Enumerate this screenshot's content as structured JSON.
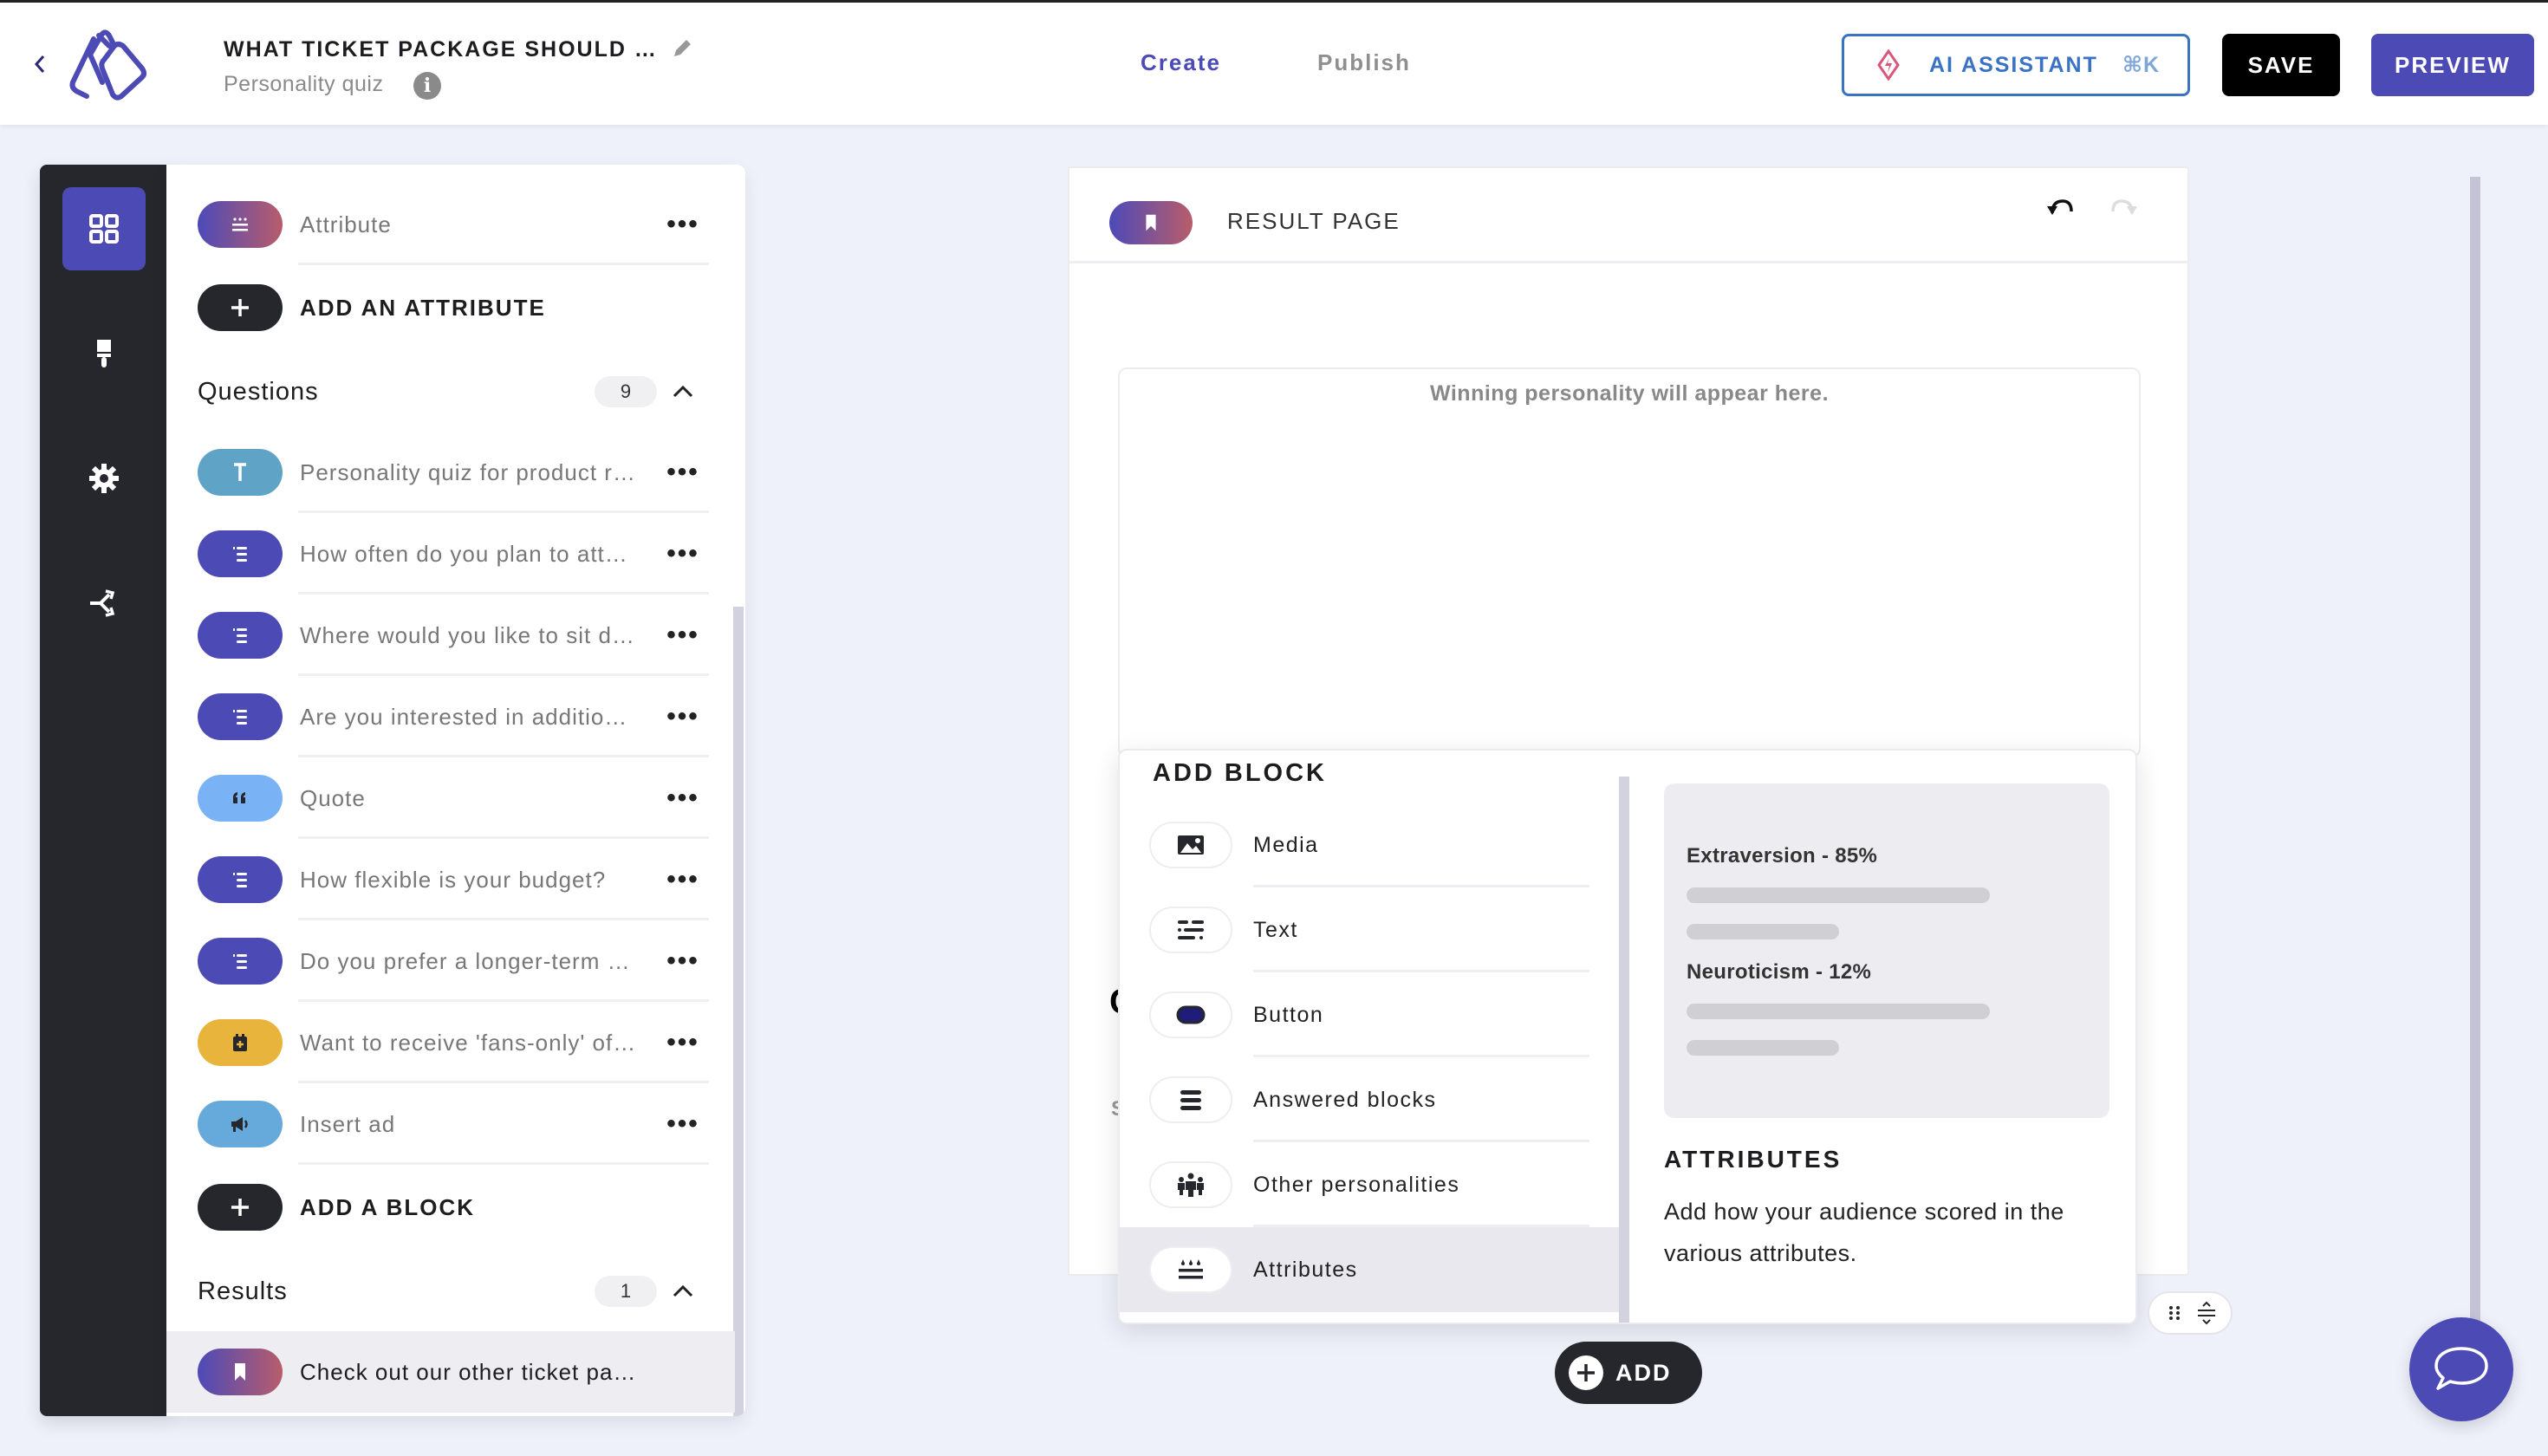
{
  "header": {
    "back_icon": "chevron-left-icon",
    "logo": "logo-icon",
    "title": "WHAT TICKET PACKAGE SHOULD …",
    "subtitle": "Personality quiz",
    "tabs": [
      {
        "label": "Create",
        "active": true
      },
      {
        "label": "Publish",
        "active": false
      }
    ],
    "ai_assistant": {
      "label": "AI ASSISTANT",
      "shortcut": "⌘K"
    },
    "save_label": "SAVE",
    "preview_label": "PREVIEW"
  },
  "rail": {
    "items": [
      {
        "name": "blocks",
        "icon": "grid-icon",
        "active": true
      },
      {
        "name": "design",
        "icon": "paintbrush-icon",
        "active": false
      },
      {
        "name": "settings",
        "icon": "gear-icon",
        "active": false
      },
      {
        "name": "logic",
        "icon": "branch-icon",
        "active": false
      }
    ]
  },
  "sidebar": {
    "attributes": [
      {
        "label": "Attribute",
        "icon": "attribute-icon"
      }
    ],
    "add_attribute_label": "ADD AN ATTRIBUTE",
    "questions": {
      "label": "Questions",
      "count": "9",
      "items": [
        {
          "label": "Personality quiz for product r…",
          "icon": "text-icon",
          "type": "text"
        },
        {
          "label": "How often do you plan to att…",
          "icon": "list-icon",
          "type": "question"
        },
        {
          "label": "Where would you like to sit d…",
          "icon": "list-icon",
          "type": "question"
        },
        {
          "label": "Are you interested in additio…",
          "icon": "list-icon",
          "type": "question"
        },
        {
          "label": "Quote",
          "icon": "quote-icon",
          "type": "quote"
        },
        {
          "label": "How flexible is your budget?",
          "icon": "list-icon",
          "type": "question"
        },
        {
          "label": "Do you prefer a longer-term …",
          "icon": "list-icon",
          "type": "question"
        },
        {
          "label": "Want to receive 'fans-only' of…",
          "icon": "calendar-plus-icon",
          "type": "form"
        },
        {
          "label": "Insert ad",
          "icon": "megaphone-icon",
          "type": "ad"
        }
      ]
    },
    "add_block_label": "ADD A BLOCK",
    "results": {
      "label": "Results",
      "count": "1",
      "items": [
        {
          "label": "Check out our other ticket pa…",
          "icon": "bookmark-icon",
          "selected": true
        }
      ]
    },
    "more_label": "•••"
  },
  "canvas": {
    "header_title": "RESULT PAGE",
    "placeholder": "Winning personality will appear here.",
    "hidden_fragment_1": "C",
    "hidden_fragment_2": "S"
  },
  "add_block_popup": {
    "title": "ADD BLOCK",
    "items": [
      {
        "label": "Media",
        "icon": "image-icon"
      },
      {
        "label": "Text",
        "icon": "text-lines-icon"
      },
      {
        "label": "Button",
        "icon": "button-icon"
      },
      {
        "label": "Answered blocks",
        "icon": "hamburger-icon"
      },
      {
        "label": "Other personalities",
        "icon": "people-icon"
      },
      {
        "label": "Attributes",
        "icon": "attribute-icon",
        "highlighted": true
      }
    ],
    "preview": {
      "sample": [
        {
          "label": "Extraversion - 85%",
          "value": 85
        },
        {
          "label": "Neuroticism - 12%",
          "value": 12
        }
      ],
      "title": "ATTRIBUTES",
      "description": "Add how your audience scored in the various attributes."
    }
  },
  "add_button_label": "ADD",
  "colors": {
    "brand": "#4c4ab5",
    "dark": "#26272d",
    "ai_blue": "#3a72c4",
    "question_pill": "#4c4ab5",
    "text_pill": "#5fa3c7",
    "quote_pill": "#7ab3f5",
    "form_pill": "#e8b43c",
    "ad_pill": "#66a9db"
  }
}
